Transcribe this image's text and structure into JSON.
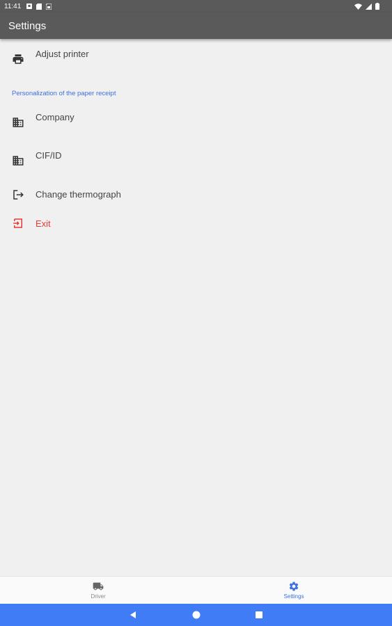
{
  "status_bar": {
    "time": "11:41",
    "left_icons": [
      "android-notification-icon",
      "sd-card-icon",
      "sim-icon"
    ],
    "right_icons": [
      "wifi-icon",
      "signal-icon",
      "battery-icon"
    ]
  },
  "app_bar": {
    "title": "Settings"
  },
  "settings": {
    "items": [
      {
        "label": "Adjust printer",
        "icon": "printer-icon"
      },
      {
        "label": "Company",
        "icon": "building-icon"
      },
      {
        "label": "CIF/ID",
        "icon": "building-icon"
      },
      {
        "label": "Change thermograph",
        "icon": "logout-icon"
      },
      {
        "label": "Exit",
        "icon": "exit-icon"
      }
    ],
    "section_header": "Personalization of the paper receipt"
  },
  "bottom_nav": {
    "tabs": [
      {
        "label": "Driver",
        "icon": "truck-icon",
        "active": false
      },
      {
        "label": "Settings",
        "icon": "gear-icon",
        "active": true
      }
    ]
  },
  "colors": {
    "app_bar": "#5a5a5a",
    "accent": "#3d6fe0",
    "danger": "#e53935",
    "system_nav": "#3f7cf5"
  }
}
